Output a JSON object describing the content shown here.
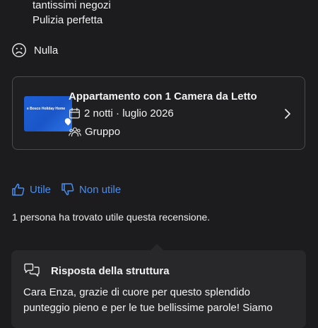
{
  "review": {
    "positive_lines": [
      "tantissimi negozi",
      "Pulizia perfetta"
    ],
    "negative_text": "Nulla",
    "negative_icon": "sad-face-icon"
  },
  "stay": {
    "thumbnail_title": "e Bosco Holiday Home",
    "thumbnail_brand_color": "#1e5fd6",
    "room_type": "Appartamento con 1 Camera da Letto",
    "duration": "2 notti · luglio 2026",
    "traveler_type": "Gruppo"
  },
  "helpful": {
    "helpful_label": "Utile",
    "not_helpful_label": "Non utile",
    "count_text": "1 persona ha trovato utile questa recensione.",
    "accent_color": "#4a8eed"
  },
  "property_response": {
    "title": "Risposta della struttura",
    "text": "Cara Enza, grazie di cuore per questo splendido punteggio pieno e per le tue bellissime parole! Siamo"
  }
}
